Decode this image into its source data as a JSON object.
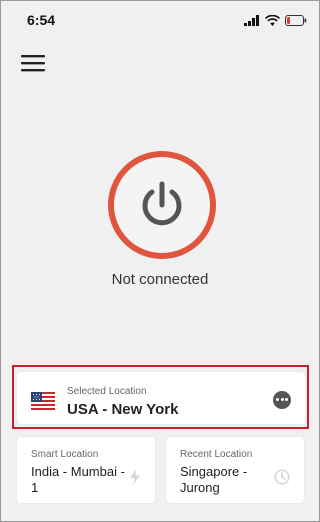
{
  "status_bar": {
    "time": "6:54"
  },
  "menu": {
    "icon": "hamburger-menu-icon"
  },
  "power": {
    "icon": "power-icon",
    "color": "#e0553d",
    "status_text": "Not connected"
  },
  "selected_location": {
    "label": "Selected Location",
    "value": "USA - New York",
    "flag": "us-flag-icon",
    "highlight_color": "#cc2026"
  },
  "smart_location": {
    "label": "Smart Location",
    "value": "India - Mumbai - 1",
    "icon": "lightning-icon"
  },
  "recent_location": {
    "label": "Recent Location",
    "value": "Singapore - Jurong",
    "icon": "clock-icon"
  }
}
